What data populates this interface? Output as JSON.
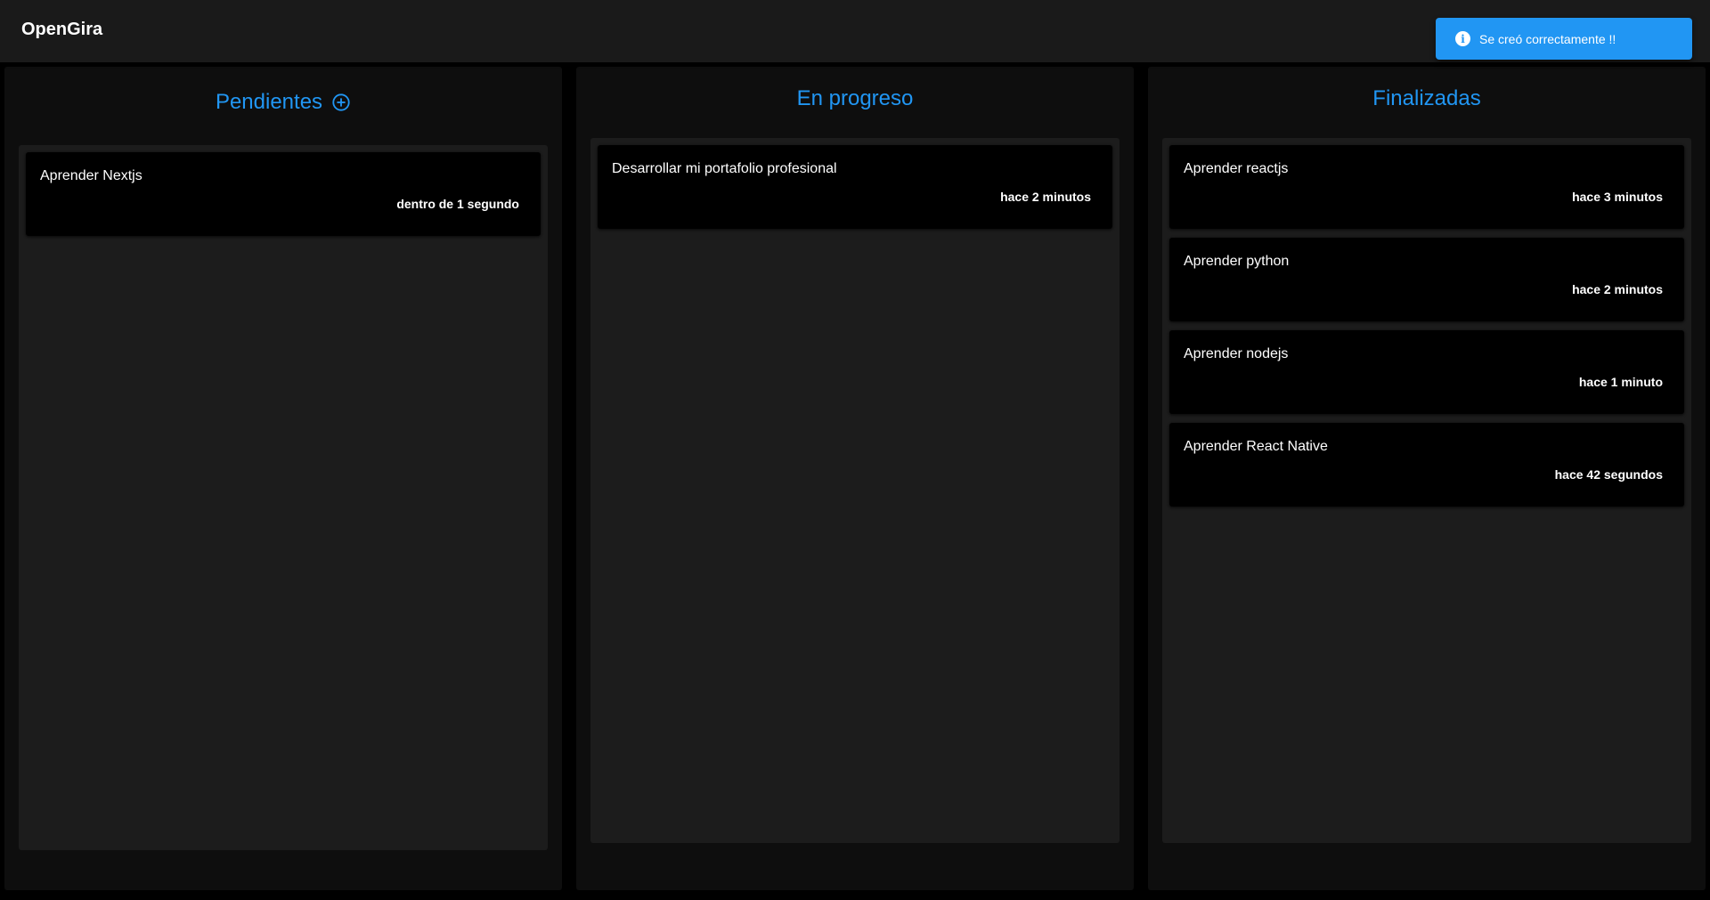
{
  "app": {
    "title": "OpenGira"
  },
  "toast": {
    "icon": "info-icon",
    "message": "Se creó correctamente !!",
    "color": "#2196f3"
  },
  "columns": [
    {
      "title": "Pendientes",
      "action_icon": "add-circle-icon",
      "cards": [
        {
          "title": "Aprender Nextjs",
          "time": "dentro de 1 segundo"
        }
      ]
    },
    {
      "title": "En progreso",
      "cards": [
        {
          "title": "Desarrollar mi portafolio profesional",
          "time": "hace 2 minutos"
        }
      ]
    },
    {
      "title": "Finalizadas",
      "cards": [
        {
          "title": "Aprender reactjs",
          "time": "hace 3 minutos"
        },
        {
          "title": "Aprender python",
          "time": "hace 2 minutos"
        },
        {
          "title": "Aprender nodejs",
          "time": "hace 1 minuto"
        },
        {
          "title": "Aprender React Native",
          "time": "hace 42 segundos"
        }
      ]
    }
  ],
  "colors": {
    "accent": "#2196f3",
    "appbar": "#1a1a1a",
    "column_bg": "#0e0e0e",
    "list_bg": "#1c1c1c",
    "card_bg": "#000000"
  }
}
